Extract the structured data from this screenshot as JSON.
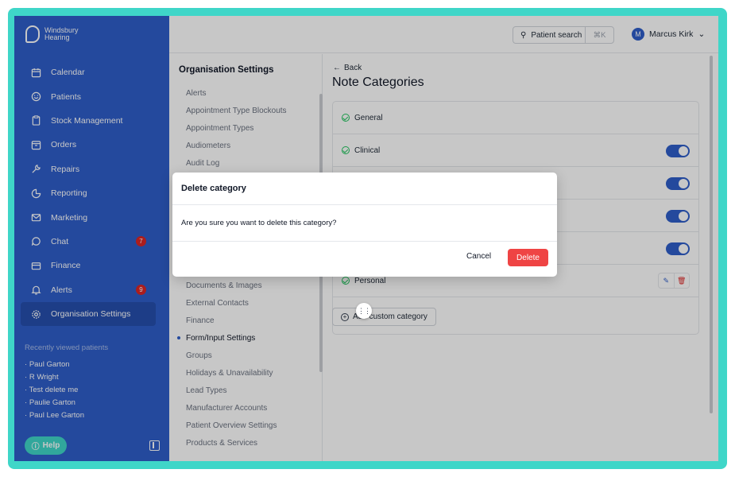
{
  "brand": {
    "line1": "Windsbury",
    "line2": "Hearing"
  },
  "sidebar": {
    "items": [
      {
        "label": "Calendar",
        "icon": "calendar-icon"
      },
      {
        "label": "Patients",
        "icon": "smile-icon"
      },
      {
        "label": "Stock Management",
        "icon": "clipboard-icon"
      },
      {
        "label": "Orders",
        "icon": "box-icon"
      },
      {
        "label": "Repairs",
        "icon": "wrench-icon"
      },
      {
        "label": "Reporting",
        "icon": "pie-chart-icon"
      },
      {
        "label": "Marketing",
        "icon": "mail-icon"
      },
      {
        "label": "Chat",
        "icon": "chat-icon",
        "badge": "7"
      },
      {
        "label": "Finance",
        "icon": "card-icon"
      },
      {
        "label": "Alerts",
        "icon": "bell-icon",
        "badge": "9"
      },
      {
        "label": "Organisation Settings",
        "icon": "gear-icon",
        "active": true
      }
    ],
    "recent_title": "Recently viewed patients",
    "recent": [
      "Paul Garton",
      "R Wright",
      "Test delete me",
      "Paulie Garton",
      "Paul Lee Garton"
    ],
    "help_label": "Help"
  },
  "topbar": {
    "search_label": "Patient search",
    "search_shortcut": "⌘K",
    "user_initial": "M",
    "user_name": "Marcus Kirk"
  },
  "settings": {
    "title": "Organisation Settings",
    "items_top": [
      "Alerts",
      "Appointment Type Blockouts",
      "Appointment Types",
      "Audiometers",
      "Audit Log"
    ],
    "items_bottom": [
      "Documents & Images",
      "External Contacts",
      "Finance",
      "Form/Input Settings",
      "Groups",
      "Holidays & Unavailability",
      "Lead Types",
      "Manufacturer Accounts",
      "Patient Overview Settings",
      "Products & Services"
    ],
    "active": "Form/Input Settings"
  },
  "main": {
    "back_label": "Back",
    "title": "Note Categories",
    "categories": [
      {
        "name": "General"
      },
      {
        "name": "Clinical"
      },
      {
        "name": ""
      },
      {
        "name": ""
      },
      {
        "name": ""
      },
      {
        "name": "Personal"
      }
    ],
    "add_label": "Add custom category"
  },
  "modal": {
    "title": "Delete category",
    "body": "Are you sure you want to delete this category?",
    "cancel_label": "Cancel",
    "delete_label": "Delete"
  },
  "colors": {
    "frame": "#3fd6c8",
    "sidebar": "#2f5ec9",
    "toggle_on": "#2f5ec9",
    "danger": "#ef4444",
    "success": "#22c55e"
  }
}
